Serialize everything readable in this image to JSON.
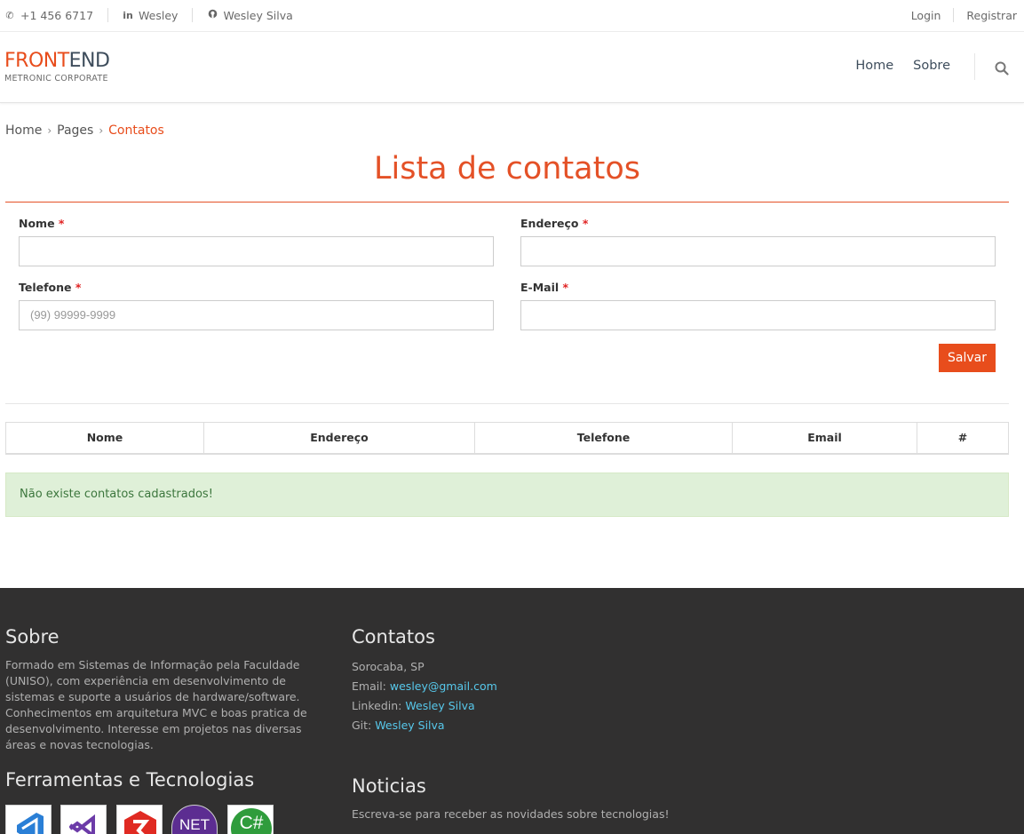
{
  "topbar": {
    "phone": "+1 456 6717",
    "linkedin": "Wesley",
    "github": "Wesley Silva",
    "login": "Login",
    "register": "Registrar"
  },
  "header": {
    "logo_part1": "FRONT",
    "logo_part2": "END",
    "logo_sub": "METRONIC CORPORATE",
    "nav": [
      "Home",
      "Sobre"
    ]
  },
  "breadcrumb": [
    "Home",
    "Pages",
    "Contatos"
  ],
  "page_title": "Lista de contatos",
  "form": {
    "required_mark": "*",
    "nome_label": "Nome",
    "endereco_label": "Endereço",
    "telefone_label": "Telefone",
    "telefone_placeholder": "(99) 99999-9999",
    "email_label": "E-Mail",
    "save_label": "Salvar"
  },
  "table": {
    "headers": [
      "Nome",
      "Endereço",
      "Telefone",
      "Email",
      "#"
    ]
  },
  "alert": "Não existe contatos cadastrados!",
  "footer": {
    "about_title": "Sobre",
    "about_text": "Formado em Sistemas de Informação pela Faculdade (UNISO), com experiência em desenvolvimento de sistemas e suporte a usuários de hardware/software. Conhecimentos em arquitetura MVC e boas pratica de desenvolvimento. Interesse em projetos nas diversas áreas e novas tecnologias.",
    "tools_title": "Ferramentas e Tecnologias",
    "contacts_title": "Contatos",
    "location": "Sorocaba, SP",
    "email_label": "Email:",
    "email_value": "wesley@gmail.com",
    "linkedin_label": "Linkedin:",
    "linkedin_value": "Wesley Silva",
    "git_label": "Git:",
    "git_value": "Wesley Silva",
    "news_title": "Noticias",
    "news_text": "Escreva-se para receber as novidades sobre tecnologias!",
    "tech_icons": [
      "vscode-icon",
      "visual-studio-icon",
      "scrum-icon",
      "dotnet-icon",
      "csharp-icon"
    ],
    "tech_labels": {
      "dotnet": "NET",
      "csharp": "C#"
    }
  },
  "colors": {
    "accent": "#e84d1c",
    "footer_bg": "#313030",
    "link": "#57c8eb",
    "alert_bg": "#dff0d8"
  }
}
